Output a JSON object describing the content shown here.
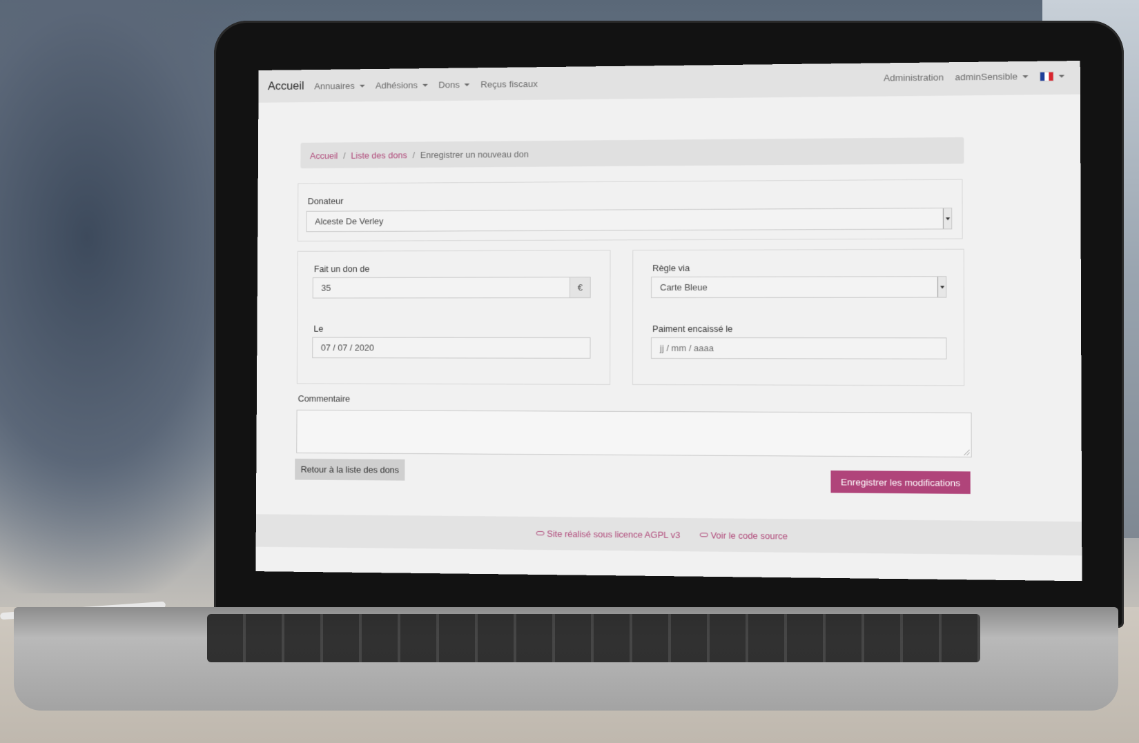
{
  "navbar": {
    "brand": "Accueil",
    "menu": [
      {
        "label": "Annuaires",
        "dropdown": true
      },
      {
        "label": "Adhésions",
        "dropdown": true
      },
      {
        "label": "Dons",
        "dropdown": true
      },
      {
        "label": "Reçus fiscaux",
        "dropdown": false
      }
    ],
    "admin": "Administration",
    "user": "adminSensible",
    "language_icon": "flag-fr-icon"
  },
  "breadcrumb": {
    "home": "Accueil",
    "list": "Liste des dons",
    "current": "Enregistrer un nouveau don",
    "separator": "/"
  },
  "form": {
    "donor": {
      "label": "Donateur",
      "value": "Alceste De Verley"
    },
    "amount": {
      "label": "Fait un don de",
      "value": "35",
      "currency": "€"
    },
    "date": {
      "label": "Le",
      "value": "07 / 07 / 2020"
    },
    "payment_method": {
      "label": "Règle via",
      "value": "Carte Bleue"
    },
    "cashed_date": {
      "label": "Paiment encaissé le",
      "placeholder": "jj / mm / aaaa"
    },
    "comment": {
      "label": "Commentaire",
      "value": ""
    }
  },
  "buttons": {
    "back": "Retour à la liste des dons",
    "save": "Enregistrer les modifications"
  },
  "footer": {
    "license": "Site réalisé sous licence AGPL v3",
    "source": "Voir le code source"
  },
  "colors": {
    "accent": "#b0447a",
    "navbar": "#e2e2e2",
    "background": "#f1f1f1"
  }
}
